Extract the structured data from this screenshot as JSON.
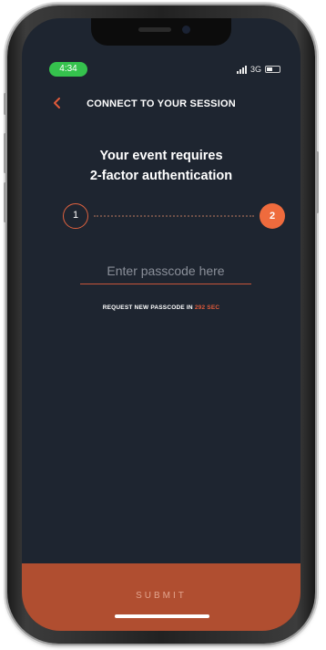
{
  "status_bar": {
    "time": "4:34",
    "network": "3G"
  },
  "header": {
    "back_icon": "chevron-left-icon",
    "title": "CONNECT TO YOUR SESSION"
  },
  "main": {
    "heading_line1": "Your event requires",
    "heading_line2": "2-factor authentication",
    "steps": [
      {
        "label": "1",
        "state": "completed"
      },
      {
        "label": "2",
        "state": "active"
      }
    ],
    "passcode": {
      "value": "",
      "placeholder": "Enter passcode here"
    },
    "resend": {
      "prefix": "REQUEST NEW PASSCODE IN",
      "countdown": "292 SEC"
    }
  },
  "footer": {
    "submit_label": "SUBMIT"
  },
  "colors": {
    "background": "#1e2530",
    "accent": "#ef6b3d",
    "submit_bar": "#b04e30",
    "status_time_pill": "#35c24d"
  }
}
